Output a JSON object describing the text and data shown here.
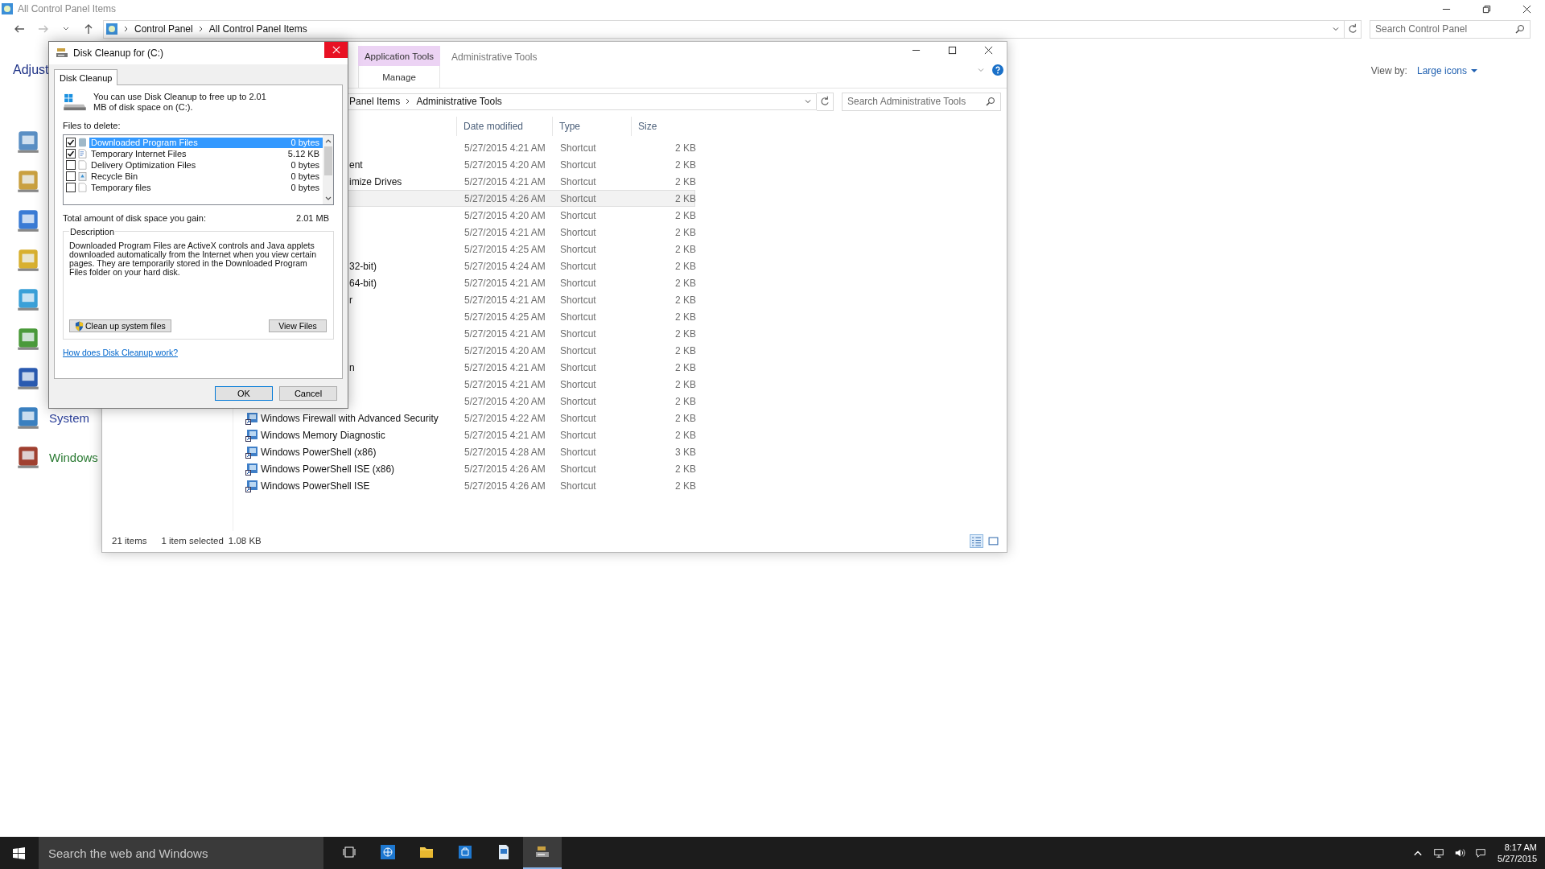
{
  "control_panel": {
    "title": "All Control Panel Items",
    "breadcrumb": [
      "Control Panel",
      "All Control Panel Items"
    ],
    "search_placeholder": "Search Control Panel",
    "heading": "Adjust",
    "view_by_label": "View by:",
    "view_by_value": "Large icons",
    "labels": [
      {
        "label": "System"
      },
      {
        "label": "Windows"
      }
    ]
  },
  "explorer": {
    "title": "Administrative Tools",
    "context_group": "Application Tools",
    "ribbon_tab": "Manage",
    "breadcrumb": [
      "Panel Items",
      "Administrative Tools"
    ],
    "search_placeholder": "Search Administrative Tools",
    "columns": [
      "Date modified",
      "Type",
      "Size"
    ],
    "rows": [
      {
        "kind": "covered",
        "date": "5/27/2015 4:21 AM",
        "type": "Shortcut",
        "size": "2 KB",
        "selected": false
      },
      {
        "kind": "covered",
        "name": "ent",
        "date": "5/27/2015 4:20 AM",
        "type": "Shortcut",
        "size": "2 KB",
        "selected": false
      },
      {
        "kind": "covered",
        "name": "imize Drives",
        "date": "5/27/2015 4:21 AM",
        "type": "Shortcut",
        "size": "2 KB",
        "selected": false
      },
      {
        "kind": "covered",
        "date": "5/27/2015 4:26 AM",
        "type": "Shortcut",
        "size": "2 KB",
        "selected": true
      },
      {
        "kind": "covered",
        "date": "5/27/2015 4:20 AM",
        "type": "Shortcut",
        "size": "2 KB",
        "selected": false
      },
      {
        "kind": "covered",
        "date": "5/27/2015 4:21 AM",
        "type": "Shortcut",
        "size": "2 KB",
        "selected": false
      },
      {
        "kind": "covered",
        "date": "5/27/2015 4:25 AM",
        "type": "Shortcut",
        "size": "2 KB",
        "selected": false
      },
      {
        "kind": "covered",
        "name": "32-bit)",
        "date": "5/27/2015 4:24 AM",
        "type": "Shortcut",
        "size": "2 KB",
        "selected": false
      },
      {
        "kind": "covered",
        "name": "64-bit)",
        "date": "5/27/2015 4:21 AM",
        "type": "Shortcut",
        "size": "2 KB",
        "selected": false
      },
      {
        "kind": "covered",
        "name": "r",
        "date": "5/27/2015 4:21 AM",
        "type": "Shortcut",
        "size": "2 KB",
        "selected": false
      },
      {
        "kind": "covered",
        "date": "5/27/2015 4:25 AM",
        "type": "Shortcut",
        "size": "2 KB",
        "selected": false
      },
      {
        "kind": "covered",
        "date": "5/27/2015 4:21 AM",
        "type": "Shortcut",
        "size": "2 KB",
        "selected": false
      },
      {
        "kind": "covered",
        "date": "5/27/2015 4:20 AM",
        "type": "Shortcut",
        "size": "2 KB",
        "selected": false
      },
      {
        "kind": "covered",
        "name": "n",
        "date": "5/27/2015 4:21 AM",
        "type": "Shortcut",
        "size": "2 KB",
        "selected": false
      },
      {
        "kind": "covered",
        "date": "5/27/2015 4:21 AM",
        "type": "Shortcut",
        "size": "2 KB",
        "selected": false
      },
      {
        "kind": "covered",
        "date": "5/27/2015 4:20 AM",
        "type": "Shortcut",
        "size": "2 KB",
        "selected": false
      },
      {
        "kind": "full",
        "name": "Windows Firewall with Advanced Security",
        "date": "5/27/2015 4:22 AM",
        "type": "Shortcut",
        "size": "2 KB",
        "selected": false
      },
      {
        "kind": "full",
        "name": "Windows Memory Diagnostic",
        "date": "5/27/2015 4:21 AM",
        "type": "Shortcut",
        "size": "2 KB",
        "selected": false
      },
      {
        "kind": "full",
        "name": "Windows PowerShell (x86)",
        "date": "5/27/2015 4:28 AM",
        "type": "Shortcut",
        "size": "3 KB",
        "selected": false
      },
      {
        "kind": "full",
        "name": "Windows PowerShell ISE (x86)",
        "date": "5/27/2015 4:26 AM",
        "type": "Shortcut",
        "size": "2 KB",
        "selected": false
      },
      {
        "kind": "full",
        "name": "Windows PowerShell ISE",
        "date": "5/27/2015 4:26 AM",
        "type": "Shortcut",
        "size": "2 KB",
        "selected": false
      }
    ],
    "status": {
      "count": "21 items",
      "selection": "1 item selected",
      "size": "1.08 KB"
    },
    "views": [
      {
        "kind": "details",
        "selected": true
      },
      {
        "kind": "large",
        "selected": false
      }
    ]
  },
  "dialog": {
    "title": "Disk Cleanup for  (C:)",
    "tabs": [
      {
        "label": "Disk Cleanup",
        "selected": true
      }
    ],
    "intro": "You can use Disk Cleanup to free up to 2.01 MB of disk space on  (C:).",
    "files_label": "Files to delete:",
    "files": [
      {
        "name": "Downloaded Program Files",
        "size": "0 bytes",
        "checked": true,
        "selected": true
      },
      {
        "name": "Temporary Internet Files",
        "size": "5.12 KB",
        "checked": true,
        "selected": false
      },
      {
        "name": "Delivery Optimization Files",
        "size": "0 bytes",
        "checked": false,
        "selected": false
      },
      {
        "name": "Recycle Bin",
        "size": "0 bytes",
        "checked": false,
        "selected": false
      },
      {
        "name": "Temporary files",
        "size": "0 bytes",
        "checked": false,
        "selected": false
      }
    ],
    "total_label": "Total amount of disk space you gain:",
    "total": "2.01 MB",
    "description_label": "Description",
    "description": "Downloaded Program Files are ActiveX controls and Java applets downloaded automatically from the Internet when you view certain pages. They are temporarily stored in the Downloaded Program Files folder on your hard disk.",
    "clean_button": "Clean up system files",
    "view_button": "View Files",
    "link": "How does Disk Cleanup work?",
    "ok": "OK",
    "cancel": "Cancel"
  },
  "taskbar": {
    "search_placeholder": "Search the web and Windows",
    "apps": [
      {
        "kind": "taskview",
        "active": false
      },
      {
        "kind": "browser",
        "active": false
      },
      {
        "kind": "folder",
        "active": false
      },
      {
        "kind": "store",
        "active": false
      },
      {
        "kind": "document",
        "active": false
      },
      {
        "kind": "cleanup",
        "active": true
      }
    ],
    "time": "8:17 AM",
    "date": "5/27/2015"
  }
}
